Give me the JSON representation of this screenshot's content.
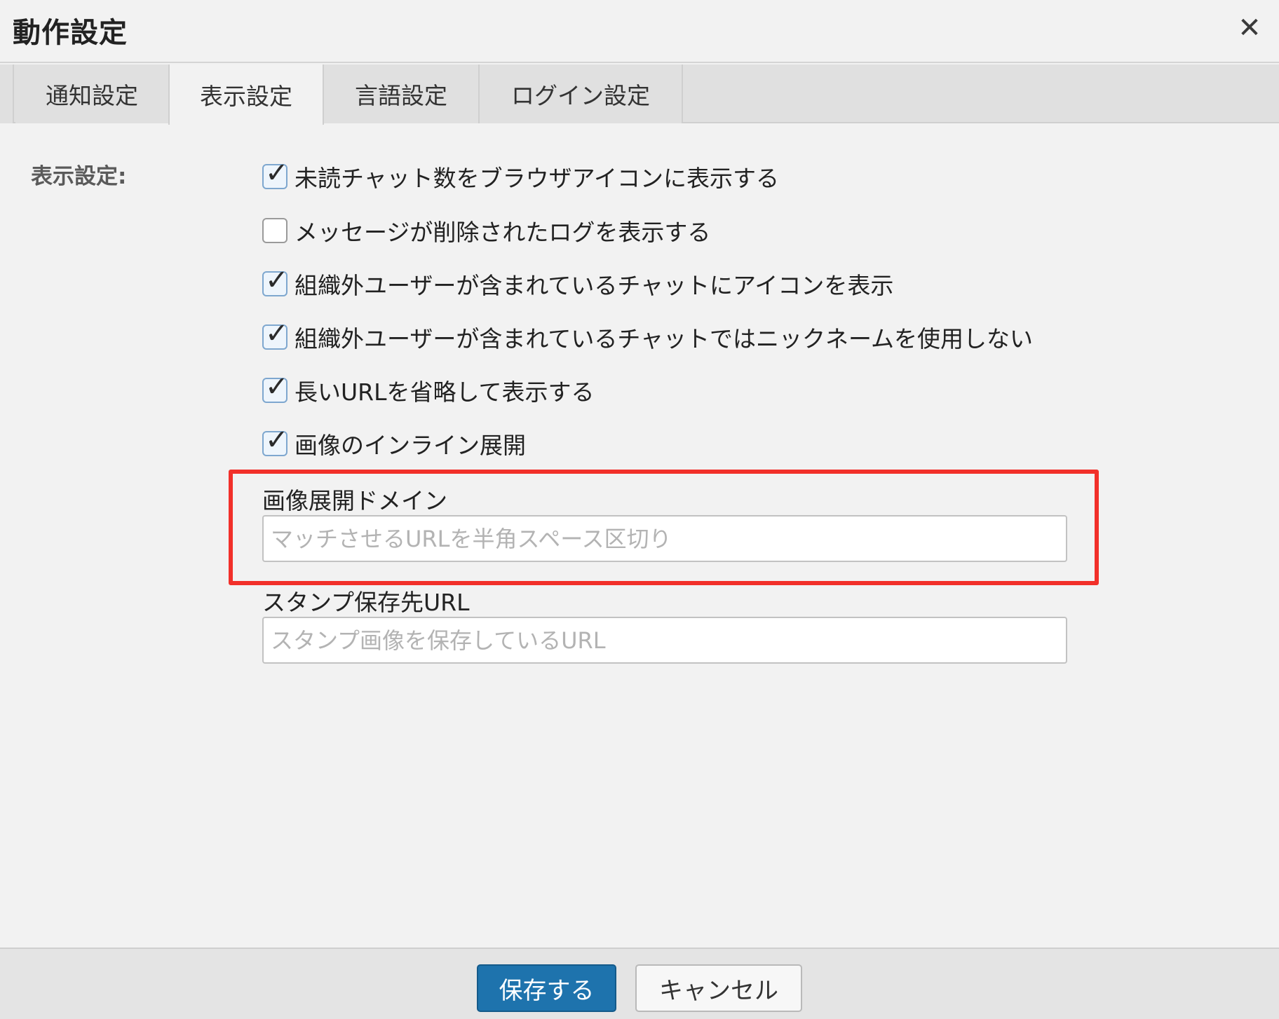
{
  "dialog": {
    "title": "動作設定",
    "close_icon": "close-icon"
  },
  "tabs": [
    {
      "label": "通知設定",
      "active": false
    },
    {
      "label": "表示設定",
      "active": true
    },
    {
      "label": "言語設定",
      "active": false
    },
    {
      "label": "ログイン設定",
      "active": false
    }
  ],
  "display": {
    "section_label": "表示設定:",
    "options": [
      {
        "label": "未読チャット数をブラウザアイコンに表示する",
        "checked": true
      },
      {
        "label": "メッセージが削除されたログを表示する",
        "checked": false
      },
      {
        "label": "組織外ユーザーが含まれているチャットにアイコンを表示",
        "checked": true
      },
      {
        "label": "組織外ユーザーが含まれているチャットではニックネームを使用しない",
        "checked": true
      },
      {
        "label": "長いURLを省略して表示する",
        "checked": true
      },
      {
        "label": "画像のインライン展開",
        "checked": true
      }
    ],
    "image_domain": {
      "label": "画像展開ドメイン",
      "value": "",
      "placeholder": "マッチさせるURLを半角スペース区切り"
    },
    "stamp_url": {
      "label": "スタンプ保存先URL",
      "value": "",
      "placeholder": "スタンプ画像を保存しているURL"
    }
  },
  "footer": {
    "save_label": "保存する",
    "cancel_label": "キャンセル"
  },
  "colors": {
    "primary_button": "#1e73ad",
    "highlight_box": "#f2302a"
  }
}
